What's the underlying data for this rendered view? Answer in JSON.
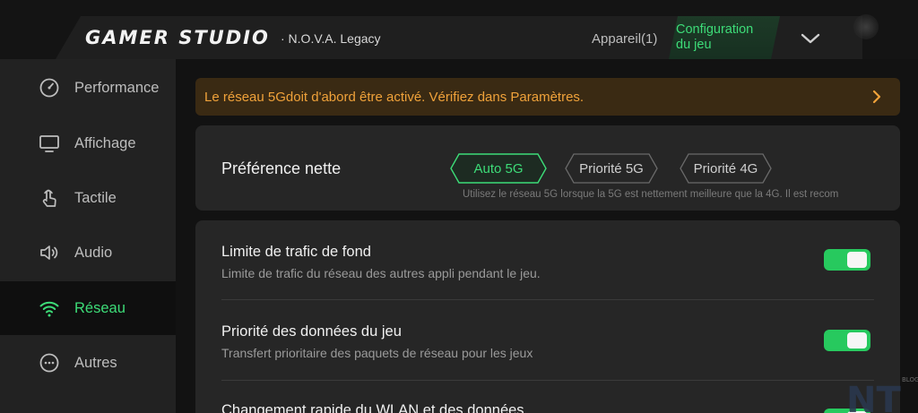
{
  "header": {
    "brand": "GAMER STUDIO",
    "game_name": "· N.O.V.A. Legacy",
    "tabs": {
      "device": "Appareil(1)",
      "config_line1": "Configuration",
      "config_line2": "du jeu"
    }
  },
  "sidebar": {
    "items": [
      {
        "label": "Performance",
        "icon": "speedometer-icon"
      },
      {
        "label": "Affichage",
        "icon": "monitor-icon"
      },
      {
        "label": "Tactile",
        "icon": "touch-icon"
      },
      {
        "label": "Audio",
        "icon": "speaker-icon"
      },
      {
        "label": "Réseau",
        "icon": "wifi-icon",
        "active": true
      },
      {
        "label": "Autres",
        "icon": "more-icon"
      }
    ]
  },
  "warning": {
    "text": "Le réseau 5Gdoit d'abord être activé. Vérifiez dans Paramètres."
  },
  "preference": {
    "title": "Préférence nette",
    "options": [
      "Auto 5G",
      "Priorité 5G",
      "Priorité 4G"
    ],
    "selected": "Auto 5G",
    "hint": "Utilisez le réseau 5G lorsque la 5G est nettement meilleure que la 4G. Il est recom"
  },
  "settings": [
    {
      "title": "Limite de trafic de fond",
      "desc": "Limite de trafic du réseau des autres appli pendant le jeu.",
      "enabled": true
    },
    {
      "title": "Priorité des données du jeu",
      "desc": "Transfert prioritaire des paquets de réseau pour les jeux",
      "enabled": true
    },
    {
      "title": "Changement rapide du WLAN et des données",
      "desc": "",
      "enabled": true
    }
  ],
  "watermark": {
    "text": "NT",
    "small": "BLOG"
  },
  "colors": {
    "accent": "#3ddc78",
    "toggle": "#27c95e",
    "warning": "#f0a23a"
  }
}
